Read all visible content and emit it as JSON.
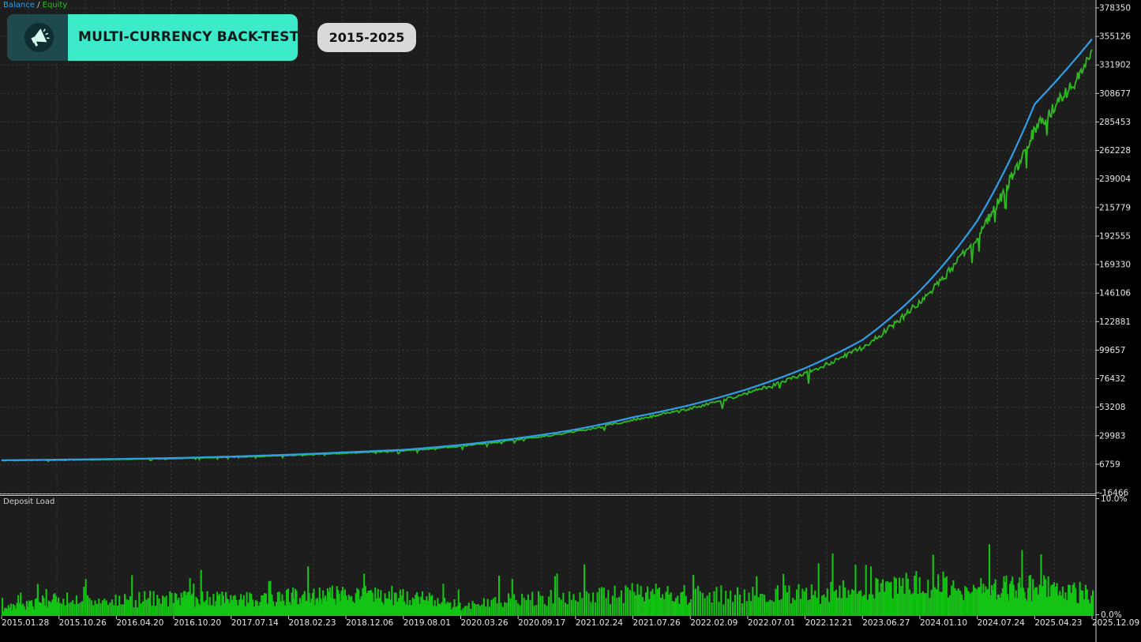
{
  "overlay": {
    "title": "MULTI-CURRENCY BACK-TEST",
    "period": "2015-2025",
    "badge_color": "#3deac9",
    "icon": "megaphone-icon"
  },
  "legend": {
    "balance_label": "Balance",
    "separator": "/",
    "equity_label": "Equity"
  },
  "subwindow": {
    "label": "Deposit Load"
  },
  "colors": {
    "balance": "#2e9ee8",
    "equity": "#2fba21",
    "deposit_load": "#14c414",
    "background": "#1d1d1d",
    "grid": "#3c3c3c",
    "axis_text": "#e6e6e6"
  },
  "chart_data": [
    {
      "type": "line",
      "ylim": [
        -16466,
        378350
      ],
      "y_ticks": [
        378350,
        355126,
        331902,
        308677,
        285453,
        262228,
        239004,
        215779,
        192555,
        169330,
        146106,
        122881,
        99657,
        76432,
        53208,
        29983,
        6759,
        -16466
      ],
      "y_tick_labels": [
        "378350",
        "355126",
        "331902",
        "308677",
        "285453",
        "262228",
        "239004",
        "215779",
        "192555",
        "169330",
        "146106",
        "122881",
        "99657",
        "76432",
        "53208",
        "29983",
        "6759",
        "-16466"
      ],
      "x_tick_labels": [
        "2015.01.28",
        "2015.10.26",
        "2016.04.20",
        "2016.10.20",
        "2017.07.14",
        "2018.02.23",
        "2018.12.06",
        "2019.08.01",
        "2020.03.26",
        "2020.09.17",
        "2021.02.24",
        "2021.07.26",
        "2022.02.09",
        "2022.07.01",
        "2022.12.21",
        "2023.06.27",
        "2024.01.10",
        "2024.07.24",
        "2025.04.23",
        "2025.12.09"
      ],
      "series": [
        {
          "name": "Balance",
          "x": [
            "2015.01.28",
            "2015.10.26",
            "2016.04.20",
            "2016.10.20",
            "2017.07.14",
            "2018.02.23",
            "2018.12.06",
            "2019.08.01",
            "2020.03.26",
            "2020.09.17",
            "2021.02.24",
            "2021.07.26",
            "2022.02.09",
            "2022.07.01",
            "2022.12.21",
            "2023.06.27",
            "2024.01.10",
            "2024.07.24",
            "2025.04.23",
            "2025.12.09"
          ],
          "y": [
            10000,
            10500,
            11000,
            11800,
            13000,
            14500,
            16500,
            18500,
            22500,
            28000,
            35000,
            45000,
            55000,
            68000,
            85000,
            108000,
            148000,
            205000,
            300000,
            353000
          ]
        },
        {
          "name": "Equity",
          "x": [
            "2015.01.28",
            "2015.10.26",
            "2016.04.20",
            "2016.10.20",
            "2017.07.14",
            "2018.02.23",
            "2018.12.06",
            "2019.08.01",
            "2020.03.26",
            "2020.09.17",
            "2021.02.24",
            "2021.07.26",
            "2022.02.09",
            "2022.07.01",
            "2022.12.21",
            "2023.06.27",
            "2024.01.10",
            "2024.07.24",
            "2025.04.23",
            "2025.12.09"
          ],
          "y": [
            10000,
            10400,
            10900,
            11600,
            12800,
            14200,
            16100,
            18100,
            21900,
            27300,
            34000,
            43800,
            53200,
            66000,
            82500,
            104000,
            142000,
            196000,
            284000,
            346000
          ]
        }
      ]
    },
    {
      "type": "bar",
      "title": "Deposit Load",
      "ylim": [
        0,
        10
      ],
      "y_tick_labels": [
        "10.0%",
        "0.0%"
      ],
      "categories": [
        "2015.01.28",
        "2015.10.26",
        "2016.04.20",
        "2016.10.20",
        "2017.07.14",
        "2018.02.23",
        "2018.12.06",
        "2019.08.01",
        "2020.03.26",
        "2020.09.17",
        "2021.02.24",
        "2021.07.26",
        "2022.02.09",
        "2022.07.01",
        "2022.12.21",
        "2023.06.27",
        "2024.01.10",
        "2024.07.24",
        "2025.04.23",
        "2025.12.09"
      ],
      "values": [
        0.8,
        1.6,
        1.5,
        1.8,
        1.6,
        1.9,
        2.1,
        2.0,
        1.0,
        1.8,
        1.9,
        2.2,
        2.1,
        2.0,
        2.3,
        2.4,
        3.2,
        2.6,
        2.8,
        2.2
      ]
    }
  ]
}
